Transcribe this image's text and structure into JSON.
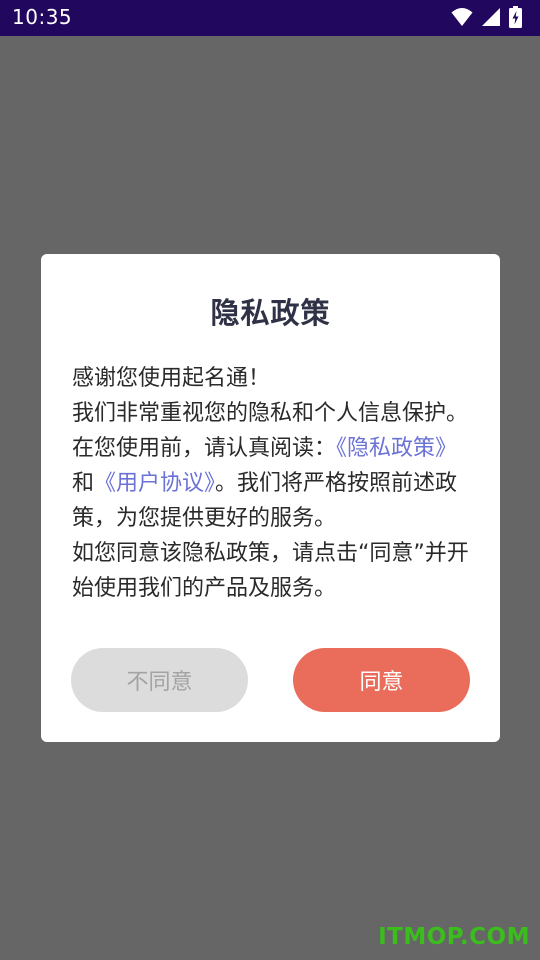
{
  "status_bar": {
    "time": "10:35",
    "icons": [
      "wifi-icon",
      "signal-icon",
      "battery-charging-icon"
    ],
    "background": "#22075e"
  },
  "dialog": {
    "title": "隐私政策",
    "body": {
      "intro": "感谢您使用起名通！\n我们非常重视您的隐私和个人信息保护。在您使用前，请认真阅读：",
      "privacy_link": "《隐私政策》",
      "connector": "和",
      "agreement_link": "《用户协议》",
      "outro": "。我们将严格按照前述政策，为您提供更好的服务。\n如您同意该隐私政策，请点击“同意”并开始使用我们的产品及服务。"
    },
    "buttons": {
      "disagree": "不同意",
      "agree": "同意"
    }
  },
  "watermark": "ITMOP.COM",
  "colors": {
    "accent": "#ea6c5b",
    "link": "#6b72d6",
    "overlay": "#666666"
  }
}
